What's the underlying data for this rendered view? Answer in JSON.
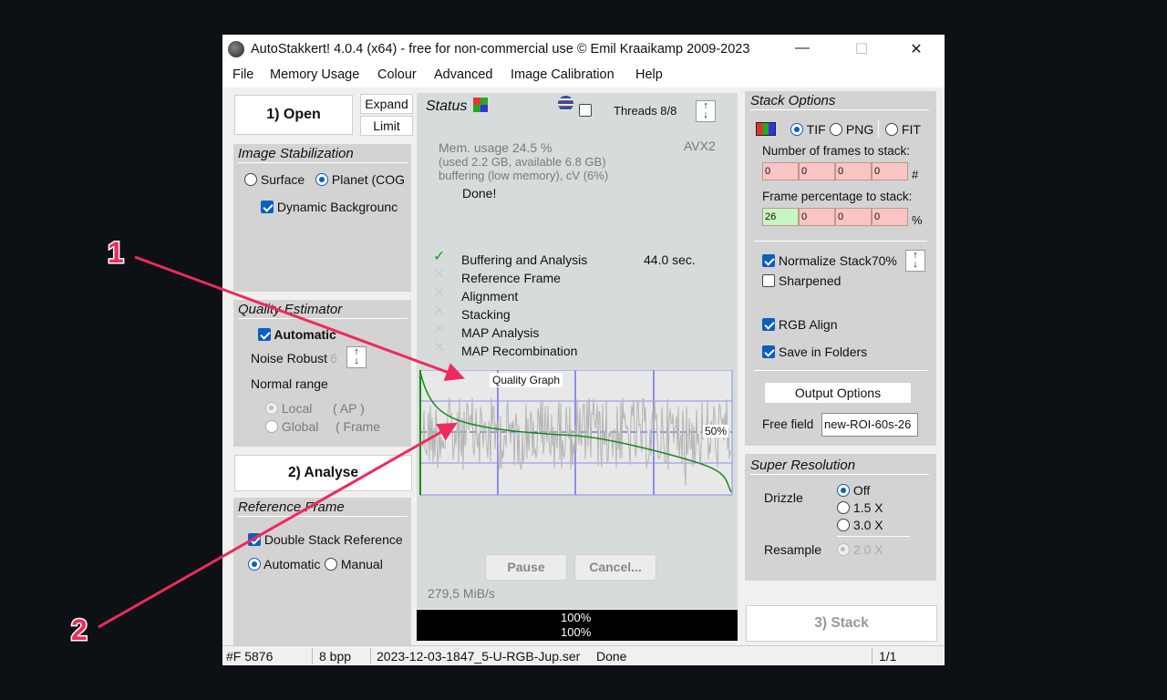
{
  "window": {
    "title": "AutoStakkert! 4.0.4 (x64) - free for non-commercial use © Emil Kraaikamp 2009-2023",
    "controls": {
      "minimize": "—",
      "maximize": "☐",
      "close": "✕"
    }
  },
  "menu": [
    "File",
    "Memory Usage",
    "Colour",
    "Advanced",
    "Image Calibration",
    "Help"
  ],
  "left": {
    "open_button": "1) Open",
    "expand_button": "Expand",
    "limit_button": "Limit",
    "image_stabilization": {
      "title": "Image Stabilization",
      "surface_label": "Surface",
      "planet_label": "Planet (COG",
      "selected": "planet",
      "dynamic_background_label": "Dynamic Backgrounc",
      "dynamic_background_checked": true
    },
    "quality_estimator": {
      "title": "Quality Estimator",
      "automatic_label": "Automatic",
      "automatic_checked": true,
      "noise_robust_label": "Noise Robust",
      "noise_robust_value": "6",
      "normal_range_label": "Normal range",
      "local_label": "Local",
      "local_ap": "( AP )",
      "global_label": "Global",
      "global_frame": "( Frame"
    },
    "analyse_button": "2) Analyse",
    "reference_frame": {
      "title": "Reference Frame",
      "double_stack_label": "Double Stack Reference",
      "double_stack_checked": true,
      "automatic_label": "Automatic",
      "manual_label": "Manual",
      "selected": "automatic"
    }
  },
  "center": {
    "status_label": "Status",
    "threads_label": "Threads 8/8",
    "avx_label": "AVX2",
    "mem_usage": "Mem. usage 24.5 %",
    "mem_detail": "(used 2.2 GB, available 6.8 GB)",
    "buffering": "buffering (low memory), cV (6%)",
    "done_text": "Done!",
    "tasks": [
      {
        "label": "Buffering and Analysis",
        "done": true,
        "time": "44.0 sec."
      },
      {
        "label": "Reference Frame",
        "done": false,
        "time": ""
      },
      {
        "label": "Alignment",
        "done": false,
        "time": ""
      },
      {
        "label": "Stacking",
        "done": false,
        "time": ""
      },
      {
        "label": "MAP Analysis",
        "done": false,
        "time": ""
      },
      {
        "label": "MAP Recombination",
        "done": false,
        "time": ""
      }
    ],
    "quality_graph_label": "Quality Graph",
    "quality_graph_pct": "50%",
    "pause_button": "Pause",
    "cancel_button": "Cancel...",
    "rate": "279,5 MiB/s",
    "progress1": "100%",
    "progress2": "100%"
  },
  "right": {
    "stack_options_title": "Stack Options",
    "format_tif": "TIF",
    "format_png": "PNG",
    "format_fit": "FIT",
    "format_selected": "tif",
    "num_frames_label": "Number of frames to stack:",
    "num_frames_values": [
      "0",
      "0",
      "0",
      "0"
    ],
    "num_frames_suffix": "#",
    "frame_pct_label": "Frame percentage to stack:",
    "frame_pct_values": [
      "26",
      "0",
      "0",
      "0"
    ],
    "frame_pct_suffix": "%",
    "normalize_label": "Normalize Stack",
    "normalize_value": "70%",
    "normalize_checked": true,
    "sharpened_label": "Sharpened",
    "sharpened_checked": false,
    "rgb_align_label": "RGB Align",
    "rgb_align_checked": true,
    "save_folders_label": "Save in Folders",
    "save_folders_checked": true,
    "output_options_button": "Output Options",
    "free_field_label": "Free field",
    "free_field_value": "new-ROI-60s-26",
    "super_resolution_title": "Super Resolution",
    "drizzle_label": "Drizzle",
    "drizzle_off": "Off",
    "drizzle_15": "1.5 X",
    "drizzle_30": "3.0 X",
    "drizzle_selected": "off",
    "resample_label": "Resample",
    "resample_20": "2.0 X",
    "stack_button": "3) Stack"
  },
  "statusbar": {
    "frames": "#F 5876",
    "bpp": "8 bpp",
    "file": "2023-12-03-1847_5-U-RGB-Jup.ser",
    "state": "Done",
    "page": "1/1"
  },
  "annotations": [
    {
      "label": "1"
    },
    {
      "label": "2"
    }
  ],
  "colors": {
    "annotation": "#ee2a5e",
    "graph_line": "#1a8a1a",
    "panel": "#d3d3d3",
    "center_panel": "#d6dcdc",
    "progress_bar": "#000000"
  }
}
